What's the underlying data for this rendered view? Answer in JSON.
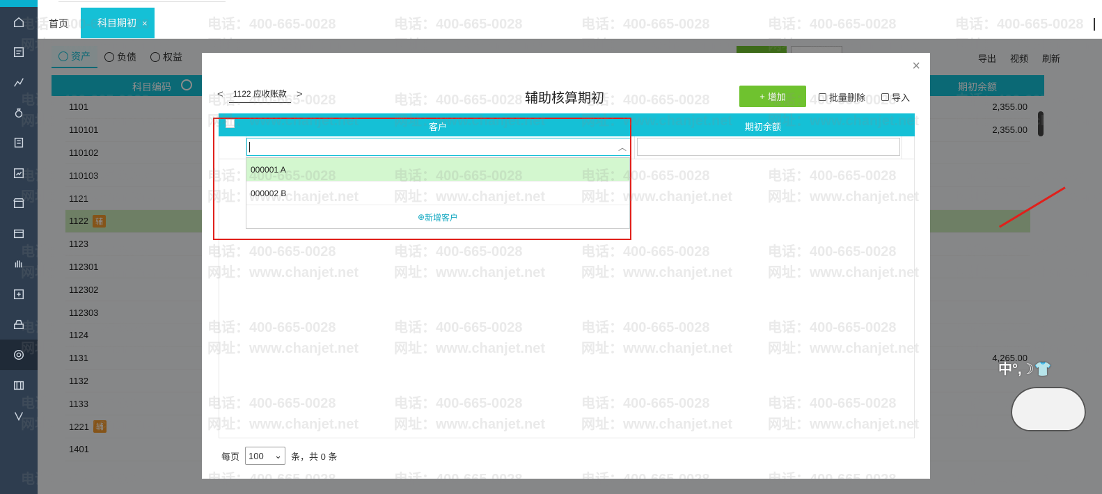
{
  "top_tabs": {
    "home": "首页",
    "active": "科目期初",
    "close": "×"
  },
  "sidebar": {
    "icons": [
      "home-icon",
      "voucher-icon",
      "chart-icon",
      "money-bag-icon",
      "book-icon",
      "report-icon",
      "store-icon",
      "invoice-icon",
      "hand-icon",
      "tax-icon",
      "cabinet-icon",
      "settings-icon",
      "film-icon",
      "v-icon"
    ]
  },
  "background_page": {
    "subtabs": [
      "资产",
      "负债",
      "权益"
    ],
    "tools": [
      "导出",
      "视频",
      "刷新"
    ],
    "headers": {
      "code": "科目编码",
      "balance": "期初余额"
    },
    "rows": [
      {
        "code": "1101",
        "tag": "",
        "amount": "2,355.00"
      },
      {
        "code": "110101",
        "tag": "",
        "amount": "2,355.00"
      },
      {
        "code": "110102",
        "tag": "",
        "amount": ""
      },
      {
        "code": "110103",
        "tag": "",
        "amount": ""
      },
      {
        "code": "1121",
        "tag": "",
        "amount": ""
      },
      {
        "code": "1122",
        "tag": "辅",
        "amount": ""
      },
      {
        "code": "1123",
        "tag": "",
        "amount": ""
      },
      {
        "code": "112301",
        "tag": "",
        "amount": ""
      },
      {
        "code": "112302",
        "tag": "",
        "amount": ""
      },
      {
        "code": "112303",
        "tag": "",
        "amount": ""
      },
      {
        "code": "1124",
        "tag": "",
        "amount": ""
      },
      {
        "code": "1131",
        "tag": "",
        "amount": "4,265.00"
      },
      {
        "code": "1132",
        "tag": "",
        "amount": ""
      },
      {
        "code": "1133",
        "tag": "",
        "amount": ""
      },
      {
        "code": "1221",
        "tag": "辅",
        "amount": ""
      },
      {
        "code": "1401",
        "tag": "",
        "amount": ""
      }
    ]
  },
  "modal": {
    "account_label": "1122 应收账款",
    "prev": "<",
    "next": ">",
    "title": "辅助核算期初",
    "close": "×",
    "add_button": "增加",
    "add_plus": "+",
    "batch_delete": "批量删除",
    "import": "导入",
    "columns": {
      "customer": "客户",
      "balance": "期初余额"
    },
    "customer_input_value": "",
    "options": [
      "000001 A",
      "000002 B"
    ],
    "new_customer": "新增客户",
    "pager": {
      "per_page": "每页",
      "page_size": "100",
      "total": "条，共 0 条"
    }
  },
  "watermark": {
    "phone": "电话：400-665-0028",
    "site": "网址：www.chanjet.net"
  },
  "ime_text": "中°,☽👕"
}
